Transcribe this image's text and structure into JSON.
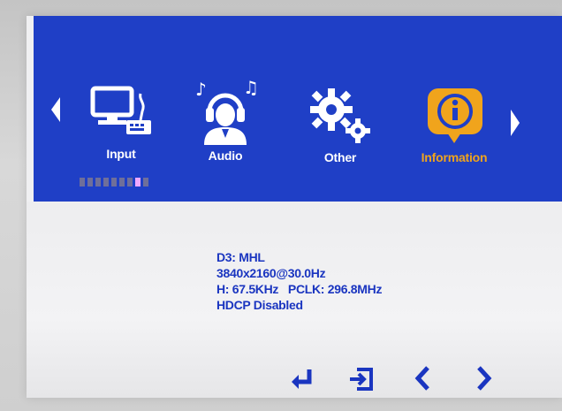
{
  "colors": {
    "menu_blue": "#1f3fc6",
    "active_orange": "#f0a41c",
    "text_blue": "#1a35c0",
    "panel_bg": "#f0f0f2"
  },
  "tabs": [
    {
      "label": "Input",
      "icon": "computer-keyboard-icon",
      "active": false
    },
    {
      "label": "Audio",
      "icon": "headphones-person-icon",
      "active": false
    },
    {
      "label": "Other",
      "icon": "gears-icon",
      "active": false
    },
    {
      "label": "Information",
      "icon": "info-icon",
      "active": true
    }
  ],
  "page_indicator": {
    "total": 9,
    "current": 8
  },
  "info": {
    "port": "D3: MHL",
    "resolution": "3840x2160@30.0Hz",
    "frequencies": "H: 67.5KHz   PCLK: 296.8MHz",
    "hdcp": "HDCP Disabled"
  },
  "bottom_nav": [
    {
      "icon": "enter-icon"
    },
    {
      "icon": "exit-icon"
    },
    {
      "icon": "chevron-left-icon"
    },
    {
      "icon": "chevron-right-icon"
    }
  ]
}
